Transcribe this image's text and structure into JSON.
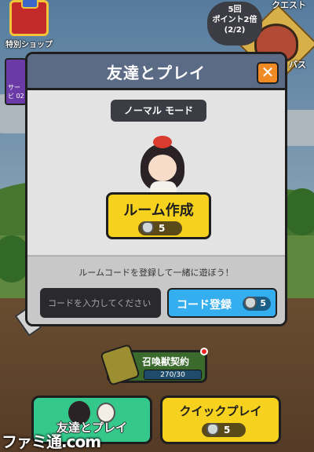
{
  "hud": {
    "shop_label": "特別ショップ",
    "side_item_label": "サービ 02",
    "quest_label": "クエスト",
    "bonus_line1": "5回",
    "bonus_line2": "ポイント2倍",
    "bonus_line3": "(2/2)",
    "boss_label": "バス"
  },
  "modal": {
    "title": "友達とプレイ",
    "close_icon": "close-icon",
    "mode_label": "ノーマル モード",
    "create_room": {
      "label": "ルーム作成",
      "cost": "5"
    },
    "hint": "ルームコードを登録して一緒に遊ぼう！",
    "code_input_placeholder": "コードを入力してください",
    "register": {
      "label": "コード登録",
      "cost": "5"
    }
  },
  "contract": {
    "label": "召喚獣契約",
    "progress_text": "270/30"
  },
  "bottom": {
    "friends_label": "友達とプレイ",
    "quick_label": "クイックプレイ",
    "quick_cost": "5"
  },
  "watermark": "ファミ通.com",
  "colors": {
    "modal_header": "#5b6b86",
    "yellow_button": "#f6d21f",
    "blue_button": "#35aef0",
    "green_button": "#34c98b",
    "close_orange": "#f08a24"
  }
}
